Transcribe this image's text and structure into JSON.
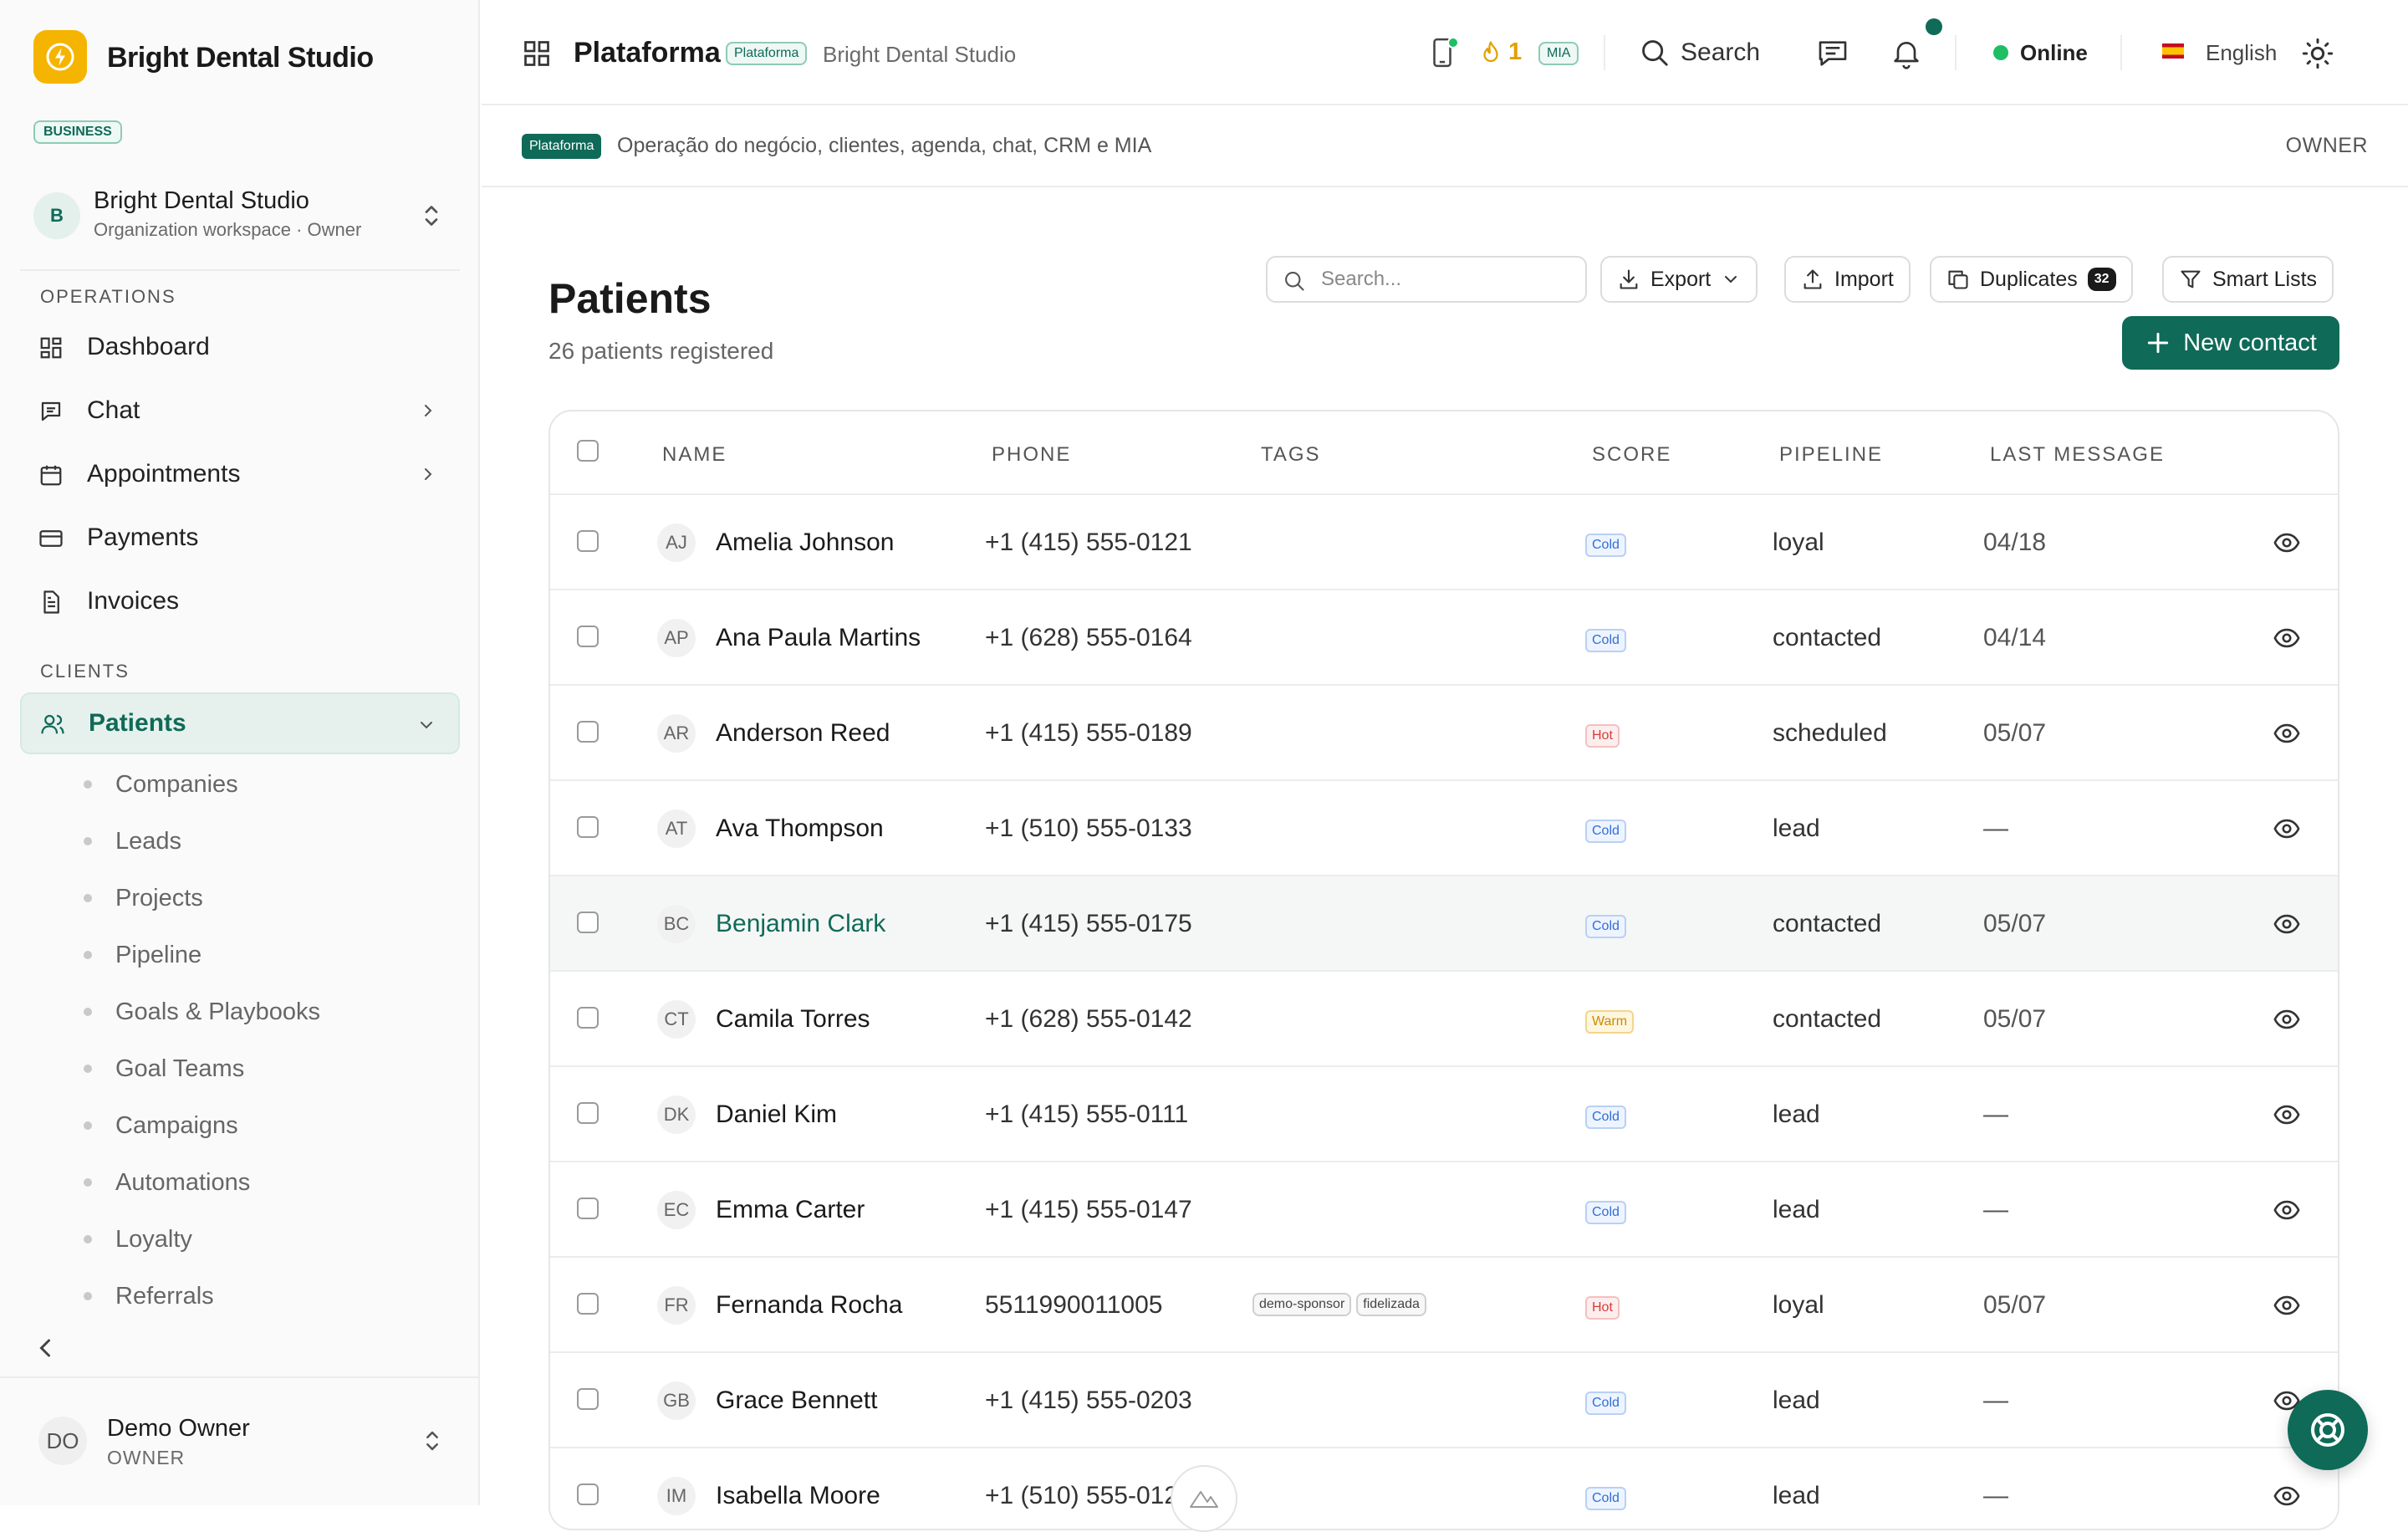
{
  "sidebar": {
    "brand": "Bright Dental Studio",
    "plan_badge": "BUSINESS",
    "org": {
      "initial": "B",
      "name": "Bright Dental Studio",
      "subtitle": "Organization workspace · Owner"
    },
    "sections": {
      "operations": "OPERATIONS",
      "clients": "CLIENTS"
    },
    "operations": [
      {
        "label": "Dashboard",
        "icon": "dashboard-icon"
      },
      {
        "label": "Chat",
        "icon": "chat-icon",
        "expandable": true
      },
      {
        "label": "Appointments",
        "icon": "calendar-icon",
        "expandable": true
      },
      {
        "label": "Payments",
        "icon": "credit-card-icon"
      },
      {
        "label": "Invoices",
        "icon": "document-icon"
      }
    ],
    "clients_active": {
      "label": "Patients",
      "icon": "users-icon"
    },
    "clients_sub": [
      "Companies",
      "Leads",
      "Projects",
      "Pipeline",
      "Goals & Playbooks",
      "Goal Teams",
      "Campaigns",
      "Automations",
      "Loyalty",
      "Referrals"
    ],
    "user": {
      "initials": "DO",
      "name": "Demo Owner",
      "role": "OWNER"
    }
  },
  "topbar": {
    "title": "Plataforma",
    "title_tag": "Plataforma",
    "subtitle": "Bright Dental Studio",
    "flame_count": "1",
    "mia_badge": "MIA",
    "search_label": "Search",
    "status": "Online",
    "language": "English"
  },
  "context": {
    "tag": "Plataforma",
    "description": "Operação do negócio, clientes, agenda, chat, CRM e MIA",
    "role": "OWNER"
  },
  "page": {
    "title": "Patients",
    "subtitle": "26 patients registered",
    "search_placeholder": "Search...",
    "buttons": {
      "export": "Export",
      "import": "Import",
      "duplicates": "Duplicates",
      "duplicates_count": "32",
      "smart_lists": "Smart Lists",
      "new_contact": "New contact"
    }
  },
  "table": {
    "columns": [
      "NAME",
      "PHONE",
      "TAGS",
      "SCORE",
      "PIPELINE",
      "LAST MESSAGE"
    ],
    "rows": [
      {
        "initials": "AJ",
        "name": "Amelia Johnson",
        "phone": "+1 (415) 555-0121",
        "tags": [],
        "score": "Cold",
        "pipeline": "loyal",
        "last": "04/18"
      },
      {
        "initials": "AP",
        "name": "Ana Paula Martins",
        "phone": "+1 (628) 555-0164",
        "tags": [],
        "score": "Cold",
        "pipeline": "contacted",
        "last": "04/14"
      },
      {
        "initials": "AR",
        "name": "Anderson Reed",
        "phone": "+1 (415) 555-0189",
        "tags": [],
        "score": "Hot",
        "pipeline": "scheduled",
        "last": "05/07"
      },
      {
        "initials": "AT",
        "name": "Ava Thompson",
        "phone": "+1 (510) 555-0133",
        "tags": [],
        "score": "Cold",
        "pipeline": "lead",
        "last": "—"
      },
      {
        "initials": "BC",
        "name": "Benjamin Clark",
        "phone": "+1 (415) 555-0175",
        "tags": [],
        "score": "Cold",
        "pipeline": "contacted",
        "last": "05/07",
        "highlighted": true
      },
      {
        "initials": "CT",
        "name": "Camila Torres",
        "phone": "+1 (628) 555-0142",
        "tags": [],
        "score": "Warm",
        "pipeline": "contacted",
        "last": "05/07"
      },
      {
        "initials": "DK",
        "name": "Daniel Kim",
        "phone": "+1 (415) 555-0111",
        "tags": [],
        "score": "Cold",
        "pipeline": "lead",
        "last": "—"
      },
      {
        "initials": "EC",
        "name": "Emma Carter",
        "phone": "+1 (415) 555-0147",
        "tags": [],
        "score": "Cold",
        "pipeline": "lead",
        "last": "—"
      },
      {
        "initials": "FR",
        "name": "Fernanda Rocha",
        "phone": "5511990011005",
        "tags": [
          "demo-sponsor",
          "fidelizada"
        ],
        "score": "Hot",
        "pipeline": "loyal",
        "last": "05/07"
      },
      {
        "initials": "GB",
        "name": "Grace Bennett",
        "phone": "+1 (415) 555-0203",
        "tags": [],
        "score": "Cold",
        "pipeline": "lead",
        "last": "—"
      },
      {
        "initials": "IM",
        "name": "Isabella Moore",
        "phone": "+1 (510) 555-012",
        "tags": [],
        "score": "Cold",
        "pipeline": "lead",
        "last": "—"
      }
    ]
  },
  "colors": {
    "accent": "#0f6a58",
    "brand_logo": "#f5b400",
    "online": "#1dbf62",
    "cold": "#2f6fd6",
    "hot": "#d63b3b",
    "warm": "#c98a00"
  }
}
